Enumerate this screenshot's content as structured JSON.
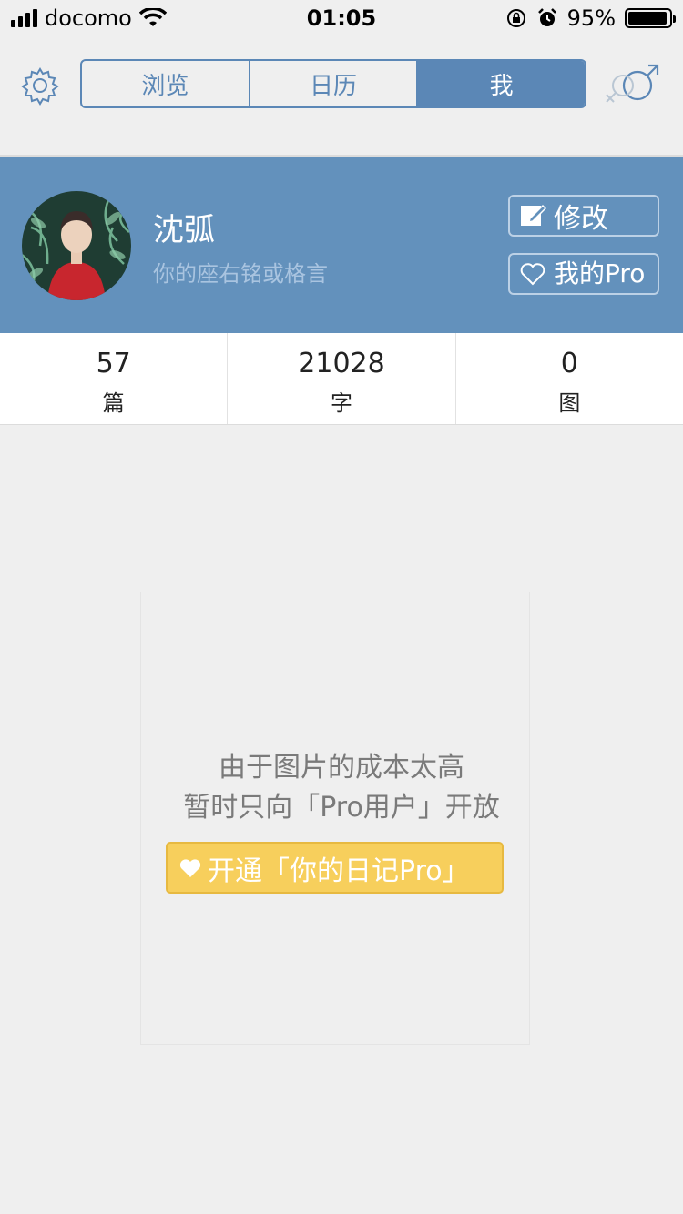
{
  "status_bar": {
    "carrier": "docomo",
    "time": "01:05",
    "battery": "95%"
  },
  "nav": {
    "tabs": [
      {
        "label": "浏览"
      },
      {
        "label": "日历"
      },
      {
        "label": "我"
      }
    ],
    "selected_tab": "我"
  },
  "profile": {
    "name": "沈弧",
    "motto": "你的座右铭或格言",
    "edit_label": "修改",
    "pro_label": "我的Pro"
  },
  "stats": [
    {
      "value": "57",
      "label": "篇"
    },
    {
      "value": "21028",
      "label": "字"
    },
    {
      "value": "0",
      "label": "图"
    }
  ],
  "notice": {
    "line1": "由于图片的成本太高",
    "line2": "暂时只向「Pro用户」开放",
    "cta": "开通「你的日记Pro」"
  },
  "colors": {
    "accent": "#5b87b6",
    "profile_bg": "#6391bc",
    "cta_bg": "#f7cf5c"
  }
}
